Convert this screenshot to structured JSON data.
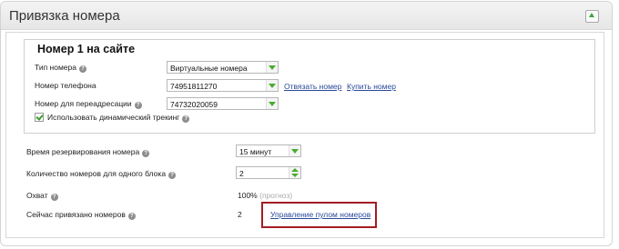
{
  "panel": {
    "title": "Привязка номера"
  },
  "number_block": {
    "title": "Номер 1 на сайте",
    "type_label": "Тип номера",
    "type_value": "Виртуальные номера",
    "phone_label": "Номер телефона",
    "phone_value": "74951811270",
    "unbind_link": "Отвязать номер",
    "buy_link": "Купить номер",
    "forward_label": "Номер для переадресации",
    "forward_value": "74732020059",
    "dynamic_tracking_label": "Использовать динамический трекинг",
    "dynamic_tracking_checked": true
  },
  "settings": {
    "reserve_time_label": "Время резервирования номера",
    "reserve_time_value": "15 минут",
    "numbers_per_block_label": "Количество номеров для одного блока",
    "numbers_per_block_value": "2",
    "coverage_label": "Охват",
    "coverage_value": "100%",
    "coverage_hint": "(прогноз)",
    "bound_now_label": "Сейчас привязано номеров",
    "bound_now_value": "2",
    "manage_pool_link": "Управление пулом номеров"
  },
  "icons": {
    "help": "question-circle-icon",
    "collapse": "chevron-up-icon"
  },
  "colors": {
    "accent_green": "#4aab2f",
    "link_blue": "#2a4a9a",
    "highlight_red": "#a31d24"
  }
}
